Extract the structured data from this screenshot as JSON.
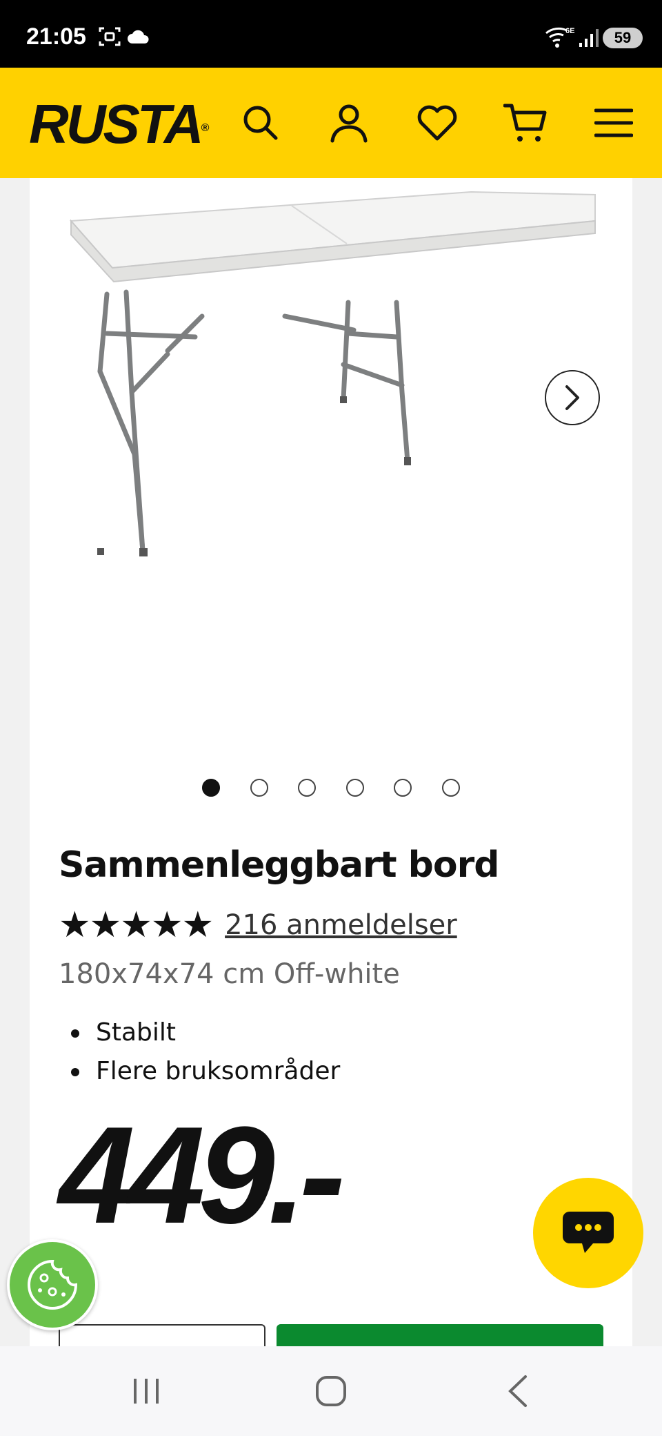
{
  "status_bar": {
    "time": "21:05",
    "network": "6E",
    "battery": "59",
    "icons": [
      "screenshot-icon",
      "cloud-icon",
      "wifi-icon",
      "signal-icon"
    ]
  },
  "header": {
    "logo": "RUSTA",
    "icons": [
      "search-icon",
      "account-icon",
      "heart-icon",
      "cart-icon",
      "menu-icon"
    ]
  },
  "product": {
    "image": "folding-table-photo",
    "carousel": {
      "total_images": 6,
      "active_index": 0
    },
    "title": "Sammenleggbart bord",
    "rating": {
      "stars": 5,
      "reviews_label": "216 anmeldelser"
    },
    "variant": "180x74x74 cm Off-white",
    "features": [
      "Stabilt",
      "Flere bruksområder"
    ],
    "price": "449.-"
  },
  "colors": {
    "brand_yellow": "#ffd100",
    "buy_green": "#0b8a2f",
    "cookie_green": "#6ac24a"
  },
  "nav": {
    "items": [
      "recent-apps-icon",
      "home-icon",
      "back-icon"
    ]
  }
}
